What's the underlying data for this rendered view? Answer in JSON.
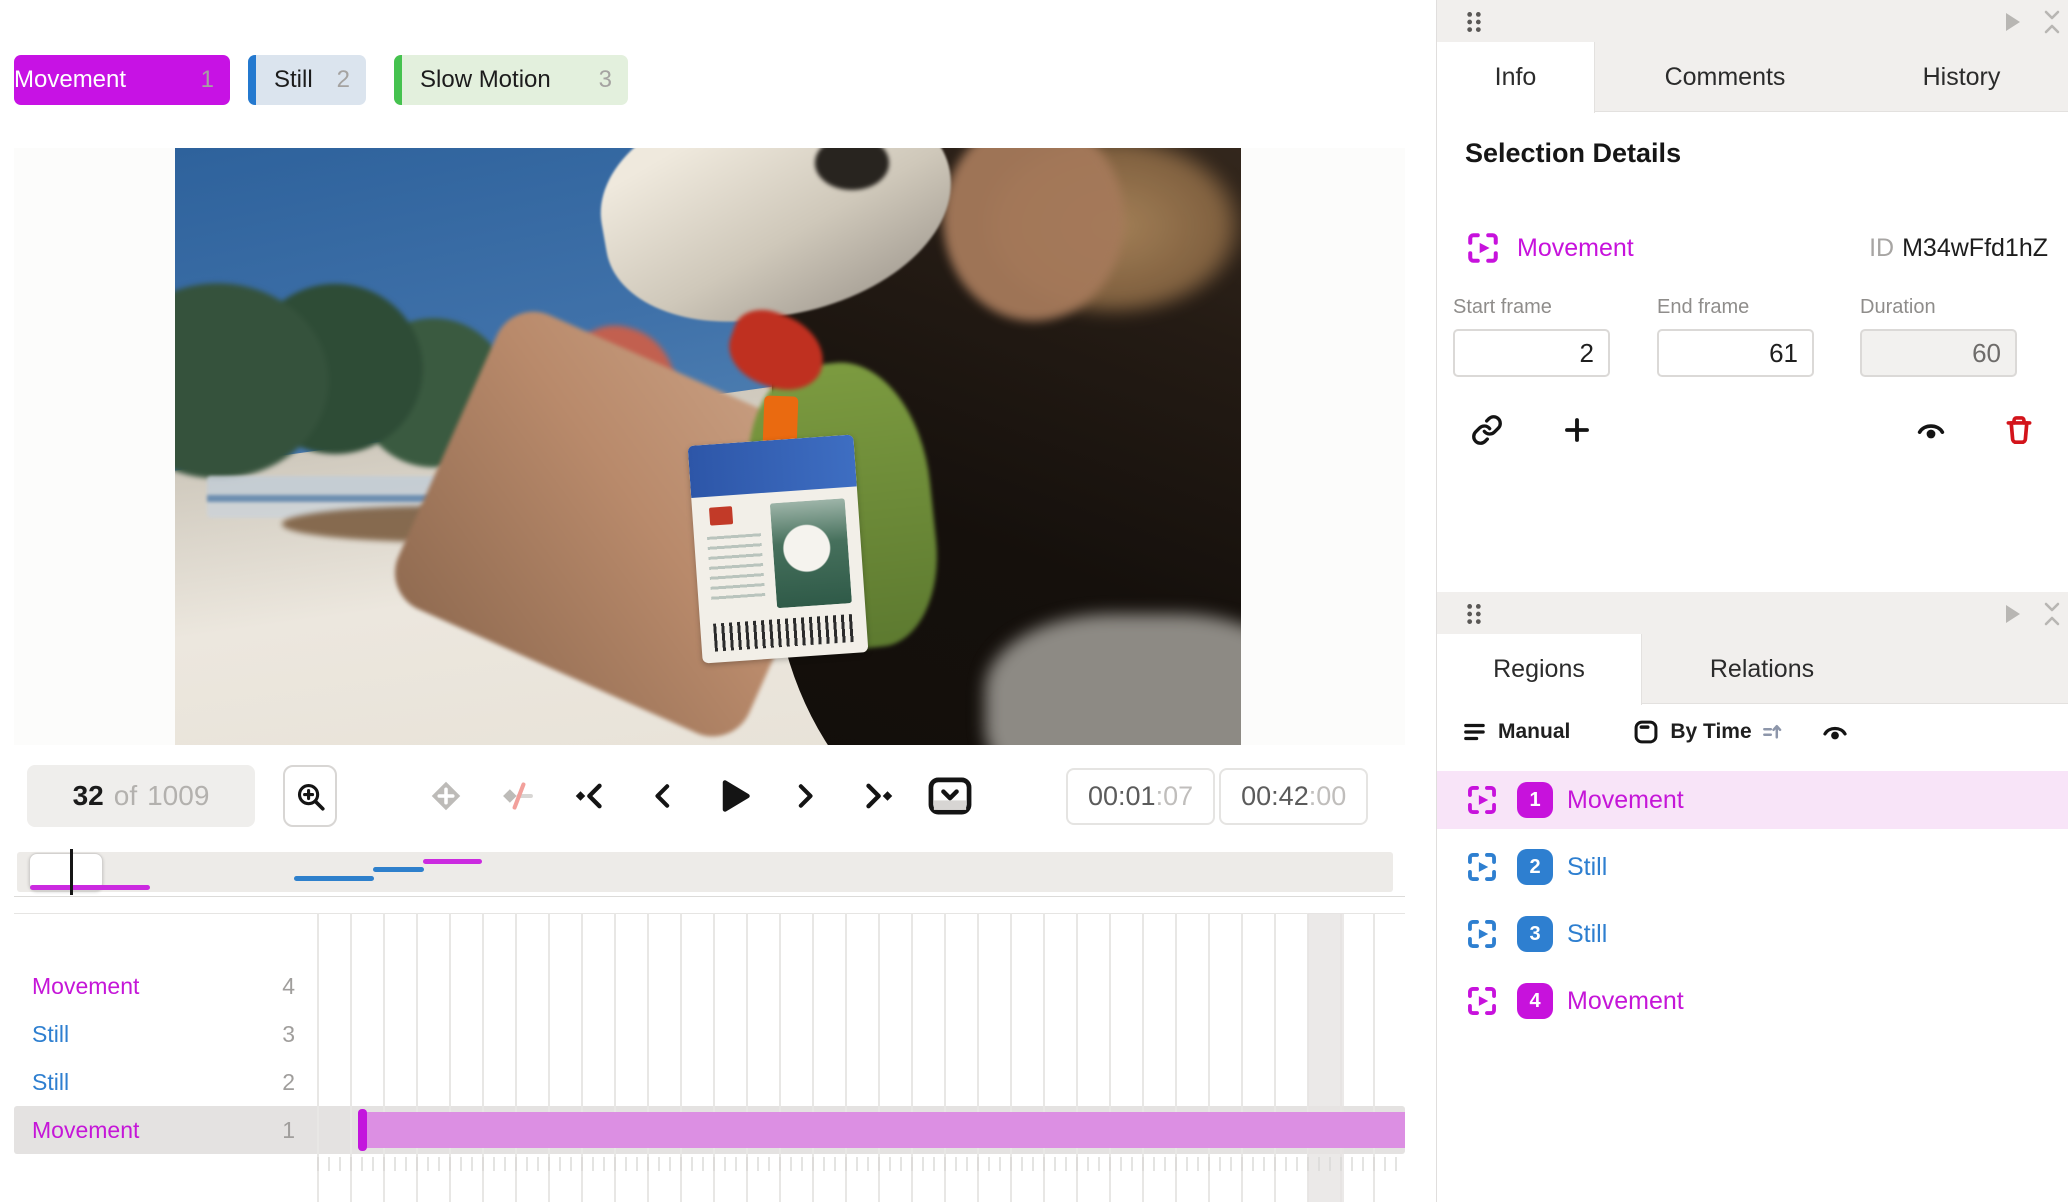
{
  "labels_toolbar": {
    "chips": [
      {
        "label": "Movement",
        "hotkey": "1",
        "color": "#c712e4",
        "state": "selected"
      },
      {
        "label": "Still",
        "hotkey": "2",
        "color": "#2479cf",
        "state": "normal"
      },
      {
        "label": "Slow Motion",
        "hotkey": "3",
        "color": "#45c24f",
        "state": "normal"
      }
    ]
  },
  "player": {
    "frame_counter": {
      "current": "32",
      "of_label": "of",
      "total": "1009"
    },
    "current_time": {
      "main": "00:01",
      "sep": ":",
      "frames": "07"
    },
    "total_time": {
      "main": "00:42",
      "sep": ":",
      "frames": "00"
    },
    "transport_icons": [
      "add-keyframe",
      "remove-keyframe",
      "previous-keyframe",
      "previous-frame",
      "play",
      "next-frame",
      "next-keyframe",
      "playback-options"
    ]
  },
  "minimap": {
    "segments": [
      {
        "track": "Movement 1",
        "color": "#cb2ae0",
        "start_pct": 1.0,
        "end_pct": 9.7
      },
      {
        "track": "Still 2",
        "color": "#2e80cc",
        "start_pct": 20.1,
        "end_pct": 25.9
      },
      {
        "track": "Still 3",
        "color": "#2e80cc",
        "start_pct": 25.9,
        "end_pct": 29.6
      },
      {
        "track": "Movement 4",
        "color": "#cb2ae0",
        "start_pct": 29.5,
        "end_pct": 33.8
      }
    ]
  },
  "tracks": {
    "rows": [
      {
        "label": "Movement",
        "number": "4",
        "color": "#c516d8"
      },
      {
        "label": "Still",
        "number": "3",
        "color": "#2e7fd0"
      },
      {
        "label": "Still",
        "number": "2",
        "color": "#2e7fd0"
      },
      {
        "label": "Movement",
        "number": "1",
        "color": "#c516d8",
        "selected": true
      }
    ],
    "selected_bar": {
      "track": "Movement 1",
      "fill": "#dc8fe3",
      "cap": "#c316dd"
    }
  },
  "info_panel": {
    "tabs": [
      {
        "label": "Info"
      },
      {
        "label": "Comments"
      },
      {
        "label": "History"
      }
    ],
    "active_tab": "Info",
    "heading": "Selection Details",
    "selection": {
      "label": "Movement",
      "id_label": "ID",
      "id_value": "M34wFfd1hZ",
      "color": "#c712dc"
    },
    "fields": [
      {
        "label": "Start frame",
        "value": "2",
        "disabled": false
      },
      {
        "label": "End frame",
        "value": "61",
        "disabled": false
      },
      {
        "label": "Duration",
        "value": "60",
        "disabled": true
      }
    ],
    "action_icons": [
      "link",
      "add",
      "visibility",
      "delete"
    ],
    "delete_color": "#d3141b"
  },
  "regions_panel": {
    "tabs": [
      {
        "label": "Regions"
      },
      {
        "label": "Relations"
      }
    ],
    "active_tab": "Regions",
    "filters": {
      "manual": "Manual",
      "by_time": "By Time"
    },
    "regions": [
      {
        "number": "1",
        "label": "Movement",
        "color": "#c712dc",
        "selected": true
      },
      {
        "number": "2",
        "label": "Still",
        "color": "#2e7fd0",
        "selected": false
      },
      {
        "number": "3",
        "label": "Still",
        "color": "#2e7fd0",
        "selected": false
      },
      {
        "number": "4",
        "label": "Movement",
        "color": "#c712dc",
        "selected": false
      }
    ]
  },
  "colors": {
    "magenta": "#c712dc",
    "blue": "#2e7fd0",
    "green": "#45c24f",
    "selected_row_pink": "#f8e4f8",
    "panel_gray": "#f1efed",
    "bar_fill": "#dc8fe3"
  }
}
